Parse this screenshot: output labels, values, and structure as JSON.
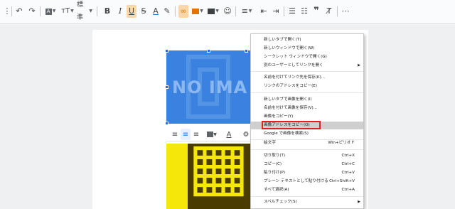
{
  "toolbar": {
    "style_select": "標準",
    "font_color_label": "A",
    "strike_label": "S",
    "bold_label": "B",
    "italic_label": "I",
    "underline_label": "U",
    "text_color_label": "A",
    "accent_highlight": "#fbd6a8"
  },
  "document": {
    "placeholder_text": "NO IMA",
    "image_bg": "#3b82e0",
    "image2_bg": "#f6e70a"
  },
  "image_toolbar": {
    "text_color_label": "A"
  },
  "context_menu": {
    "items": [
      {
        "label": "新しいタブで開く(T)"
      },
      {
        "label": "新しいウィンドウで開く(W)"
      },
      {
        "label": "シークレット ウィンドウで開く(G)"
      },
      {
        "label": "別のユーザーとしてリンクを開く",
        "submenu": true
      },
      {
        "label": "名前を付けてリンク先を保存(K)..."
      },
      {
        "label": "リンクのアドレスをコピー(E)"
      },
      {
        "label": "新しいタブで画像を開く(I)"
      },
      {
        "label": "名前を付けて画像を保存(V)..."
      },
      {
        "label": "画像をコピー(Y)"
      },
      {
        "label": "画像アドレスをコピー(O)",
        "highlighted": true
      },
      {
        "label": "Google で画像を検索(S)"
      },
      {
        "label": "絵文字",
        "shortcut": "Win+ピリオド"
      },
      {
        "label": "切り取り(T)",
        "shortcut": "Ctrl+X"
      },
      {
        "label": "コピー(C)",
        "shortcut": "Ctrl+C"
      },
      {
        "label": "貼り付け(P)",
        "shortcut": "Ctrl+V"
      },
      {
        "label": "プレーン テキストとして貼り付ける",
        "shortcut": "Ctrl+Shift+V"
      },
      {
        "label": "すべて選択(A)",
        "shortcut": "Ctrl+A"
      },
      {
        "label": "スペルチェック(S)",
        "submenu": true
      }
    ]
  }
}
